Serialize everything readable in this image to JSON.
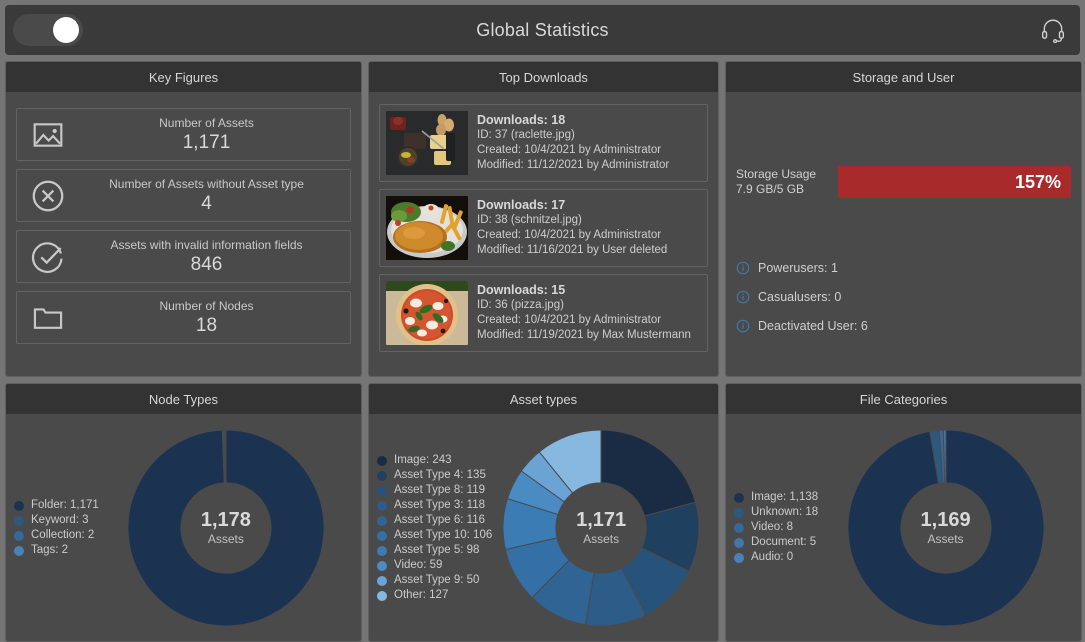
{
  "header": {
    "title": "Global Statistics",
    "toggle_state": "on",
    "support_icon": "headset-icon"
  },
  "colors": {
    "page_background": "#757575",
    "panel_background": "#4a4a4a",
    "panel_header": "#333333",
    "storage_bar": "#a82a2a",
    "info_icon": "#3e7cb1"
  },
  "key_figures": {
    "title": "Key Figures",
    "items": [
      {
        "icon": "image-icon",
        "label": "Number of Assets",
        "value": "1,171"
      },
      {
        "icon": "x-circle-icon",
        "label": "Number of Assets without Asset type",
        "value": "4"
      },
      {
        "icon": "check-circle-icon",
        "label": "Assets with invalid information fields",
        "value": "846"
      },
      {
        "icon": "folder-icon",
        "label": "Number of Nodes",
        "value": "18"
      }
    ]
  },
  "top_downloads": {
    "title": "Top Downloads",
    "items": [
      {
        "thumbnail": "raclette-thumbnail",
        "downloads": "Downloads: 18",
        "id": "ID: 37 (raclette.jpg)",
        "created": "Created: 10/4/2021 by Administrator",
        "modified": "Modified: 11/12/2021 by Administrator"
      },
      {
        "thumbnail": "schnitzel-thumbnail",
        "downloads": "Downloads: 17",
        "id": "ID: 38 (schnitzel.jpg)",
        "created": "Created: 10/4/2021 by Administrator",
        "modified": "Modified: 11/16/2021 by User deleted"
      },
      {
        "thumbnail": "pizza-thumbnail",
        "downloads": "Downloads: 15",
        "id": "ID: 36 (pizza.jpg)",
        "created": "Created: 10/4/2021 by Administrator",
        "modified": "Modified: 11/19/2021 by Max Mustermann"
      }
    ]
  },
  "storage_and_user": {
    "title": "Storage and User",
    "storage_label_line1": "Storage Usage",
    "storage_label_line2": "7.9 GB/5 GB",
    "storage_percent": "157%",
    "users": [
      {
        "icon": "info-icon",
        "label": "Powerusers: 1"
      },
      {
        "icon": "info-icon",
        "label": "Casualusers: 0"
      },
      {
        "icon": "info-icon",
        "label": "Deactivated User: 6"
      }
    ]
  },
  "chart_data": [
    {
      "type": "pie",
      "title": "Node Types",
      "center_value": "1,178",
      "center_label": "Assets",
      "legend_position": "left",
      "categories": [
        "Folder",
        "Keyword",
        "Collection",
        "Tags"
      ],
      "values": [
        1171,
        3,
        2,
        2
      ],
      "labels": [
        "Folder: 1,171",
        "Keyword: 3",
        "Collection: 2",
        "Tags: 2"
      ],
      "colors": [
        "#1b3350",
        "#2d587f",
        "#36699a",
        "#4a82b8"
      ]
    },
    {
      "type": "pie",
      "title": "Asset types",
      "center_value": "1,171",
      "center_label": "Assets",
      "legend_position": "left",
      "categories": [
        "Image",
        "Asset Type 4",
        "Asset Type 8",
        "Asset Type 3",
        "Asset Type 6",
        "Asset Type 10",
        "Asset Type 5",
        "Video",
        "Asset Type 9",
        "Other"
      ],
      "values": [
        243,
        135,
        119,
        118,
        116,
        106,
        98,
        59,
        50,
        127
      ],
      "labels": [
        "Image: 243",
        "Asset Type 4: 135",
        "Asset Type 8: 119",
        "Asset Type 3: 118",
        "Asset Type 6: 116",
        "Asset Type 10: 106",
        "Asset Type 5: 98",
        "Video: 59",
        "Asset Type 9: 50",
        "Other: 127"
      ],
      "colors": [
        "#192c44",
        "#20405f",
        "#27527a",
        "#2c5c87",
        "#2f6494",
        "#3470a6",
        "#3b7cb5",
        "#4a8bc4",
        "#6ba3d4",
        "#87b8e0"
      ]
    },
    {
      "type": "pie",
      "title": "File Categories",
      "center_value": "1,169",
      "center_label": "Assets",
      "legend_position": "left",
      "categories": [
        "Image",
        "Unknown",
        "Video",
        "Document",
        "Audio"
      ],
      "values": [
        1138,
        18,
        8,
        5,
        0
      ],
      "labels": [
        "Image: 1,138",
        "Unknown: 18",
        "Video: 8",
        "Document: 5",
        "Audio: 0"
      ],
      "colors": [
        "#1b3350",
        "#2d587f",
        "#36699a",
        "#4178ab",
        "#4a82b8"
      ]
    }
  ]
}
